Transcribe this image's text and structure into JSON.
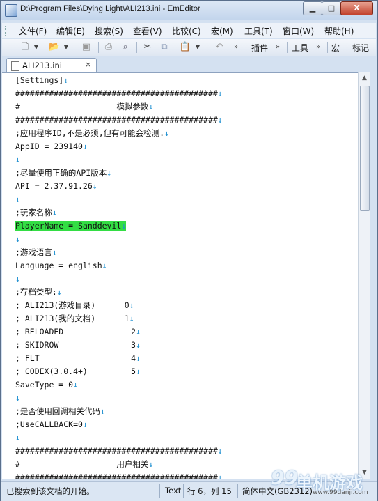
{
  "window": {
    "title": "D:\\Program Files\\Dying Light\\ALI213.ini - EmEditor",
    "minimize_label": "▁",
    "maximize_label": "□",
    "close_label": "X"
  },
  "menu": {
    "items": [
      "文件(F)",
      "编辑(E)",
      "搜索(S)",
      "查看(V)",
      "比较(C)",
      "宏(M)",
      "工具(T)",
      "窗口(W)",
      "帮助(H)"
    ]
  },
  "toolbar": {
    "plugins_label": "插件",
    "tools_label": "工具",
    "macro_label": "宏",
    "bookmark_label": "标记",
    "icons": [
      "new-file-icon",
      "open-folder-icon",
      "save-icon",
      "print-icon",
      "print-preview-icon",
      "cut-icon",
      "copy-icon",
      "paste-icon",
      "undo-icon"
    ]
  },
  "tab": {
    "label": "ALI213.ini",
    "close": "×"
  },
  "editor": {
    "eol_mark": "↓",
    "lines": [
      {
        "text": "[Settings]"
      },
      {
        "text": "##########################################"
      },
      {
        "text": "#                    模拟参数"
      },
      {
        "text": "##########################################"
      },
      {
        "text": ";应用程序ID,不是必须,但有可能会检测."
      },
      {
        "text": "AppID = 239140"
      },
      {
        "text": ""
      },
      {
        "text": ";尽量使用正确的API版本"
      },
      {
        "text": "API = 2.37.91.26"
      },
      {
        "text": ""
      },
      {
        "text": ";玩家名称"
      },
      {
        "text": "PlayerName = Sanddevil",
        "highlight": true
      },
      {
        "text": ""
      },
      {
        "text": ";游戏语言"
      },
      {
        "text": "Language = english"
      },
      {
        "text": ""
      },
      {
        "text": ";存档类型:"
      },
      {
        "text": "; ALI213(游戏目录)      0"
      },
      {
        "text": "; ALI213(我的文档)      1"
      },
      {
        "text": "; RELOADED              2"
      },
      {
        "text": "; SKIDROW               3"
      },
      {
        "text": "; FLT                   4"
      },
      {
        "text": "; CODEX(3.0.4+)         5"
      },
      {
        "text": "SaveType = 0"
      },
      {
        "text": ""
      },
      {
        "text": ";是否使用回调相关代码"
      },
      {
        "text": ";UseCALLBACK=0"
      },
      {
        "text": ""
      },
      {
        "text": "##########################################"
      },
      {
        "text": "#                    用户相关"
      },
      {
        "text": "##########################################"
      }
    ],
    "highlight_color": "#33dd44",
    "eol_color": "#1d8fd0"
  },
  "statusbar": {
    "message": "已搜索到该文档的开始。",
    "mode": "Text",
    "position": "行 6，列 15",
    "encoding": "简体中文(GB2312)"
  },
  "watermark": {
    "logo": "99",
    "name": "单机游戏",
    "url": "www.99danji.com"
  }
}
